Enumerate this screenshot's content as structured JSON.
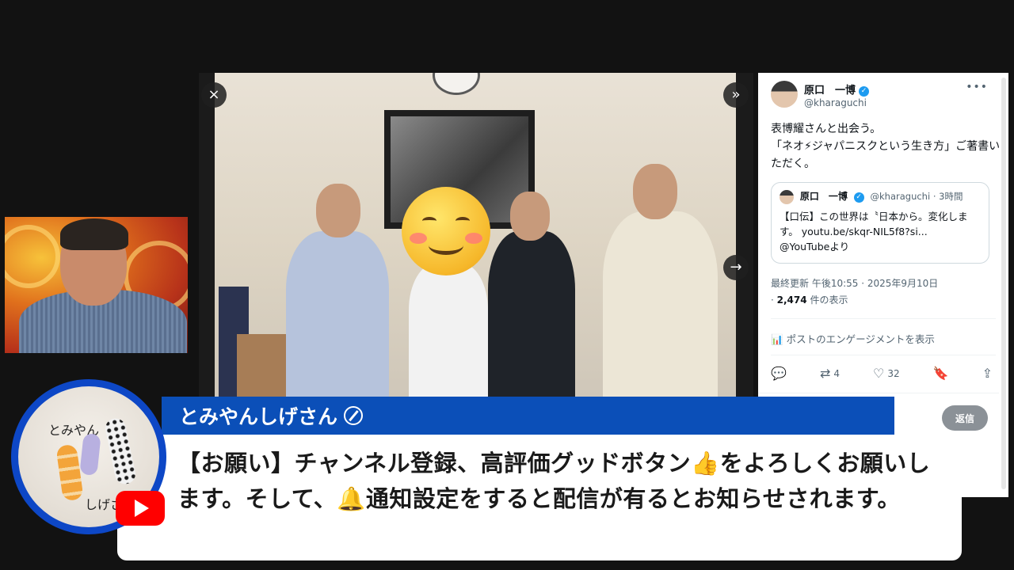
{
  "viewer": {
    "close_icon": "×",
    "next_icon": "»",
    "arrow_icon": "→"
  },
  "tweet": {
    "author_name": "原口　一博",
    "author_handle": "@kharaguchi",
    "body": "表博耀さんと出会う。\n「ネオ⚡ジャパニスクという生き方」ご著書いただく。",
    "quote": {
      "name": "原口　一博",
      "handle": "@kharaguchi · 3時間",
      "text": "【口伝】この世界は〝日本から。変化します。 youtu.be/skqr-NIL5f8?si...\n@YouTubeより"
    },
    "timestamp": "最終更新 午後10:55 · 2025年9月10日",
    "views_count": "2,474",
    "views_label": "件の表示",
    "engagement_label": "ポストのエンゲージメントを表示",
    "retweet_count": "4",
    "like_count": "32",
    "reply_button": "返信"
  },
  "overlay": {
    "channel_name": "とみやんしげさん",
    "message": "【お願い】チャンネル登録、高評価グッドボタン👍をよろしくお願いします。そして、🔔通知設定をすると配信が有るとお知らせされます。",
    "avatar_text_top": "とみやん",
    "avatar_text_bottom": "しげさん"
  },
  "colors": {
    "banner": "#0b4fb8",
    "avatar_ring": "#0d47c6",
    "youtube_red": "#ff0000",
    "verified_blue": "#1d9bf0"
  },
  "icons": [
    "close-icon",
    "fast-forward-icon",
    "next-arrow-icon",
    "verified-icon",
    "more-icon",
    "analytics-icon",
    "reply-icon",
    "retweet-icon",
    "like-icon",
    "bookmark-icon",
    "share-icon",
    "youtube-icon"
  ]
}
